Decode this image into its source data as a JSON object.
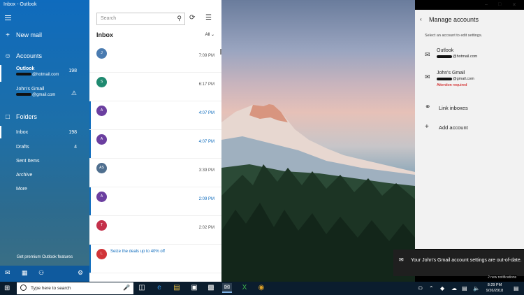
{
  "window": {
    "title": "Inbox - Outlook"
  },
  "nav": {
    "new_mail": "New mail",
    "accounts_header": "Accounts",
    "accounts": [
      {
        "name": "Outlook",
        "email": "@hotmail.com",
        "count": "198"
      },
      {
        "name": "John's Gmail",
        "email": "@gmail.com"
      }
    ],
    "folders_header": "Folders",
    "folders": [
      {
        "name": "Inbox",
        "count": "198"
      },
      {
        "name": "Drafts",
        "count": "4"
      },
      {
        "name": "Sent Items"
      },
      {
        "name": "Archive"
      },
      {
        "name": "More"
      }
    ],
    "premium": "Get premium Outlook features"
  },
  "list": {
    "search_placeholder": "Search",
    "header": "Inbox",
    "filter": "All",
    "messages": [
      {
        "initial": "J",
        "color": "#4a7bb0",
        "time": "7:09 PM",
        "unread": false
      },
      {
        "initial": "S",
        "color": "#1f8a70",
        "time": "6:17 PM",
        "unread": false
      },
      {
        "initial": "A",
        "color": "#6b3fa0",
        "time": "4:07 PM",
        "unread": true
      },
      {
        "initial": "A",
        "color": "#6b3fa0",
        "time": "4:07 PM",
        "unread": true
      },
      {
        "initial": "AS",
        "color": "#4f6f8f",
        "time": "3:39 PM",
        "unread": false
      },
      {
        "initial": "A",
        "color": "#6b3fa0",
        "time": "2:09 PM",
        "unread": true
      },
      {
        "initial": "T",
        "color": "#c4314b",
        "time": "2:02 PM",
        "unread": false
      },
      {
        "initial": "L",
        "color": "#d13438",
        "time": "",
        "snippet": "Seize the deals up to 40% off",
        "unread": true
      }
    ]
  },
  "panel": {
    "title": "Manage accounts",
    "hint": "Select an account to edit settings.",
    "accounts": [
      {
        "name": "Outlook",
        "email": "@hotmail.com"
      },
      {
        "name": "John's Gmail",
        "email": "@gmail.com",
        "alert": "Attention required"
      }
    ],
    "link_inboxes": "Link inboxes",
    "add_account": "Add account"
  },
  "toast": {
    "text": "Your John's Gmail account settings are out-of-date."
  },
  "new_notifications": "2 new notifications",
  "taskbar": {
    "search_placeholder": "Type here to search",
    "time": "8:29 PM",
    "date": "9/26/2018"
  }
}
